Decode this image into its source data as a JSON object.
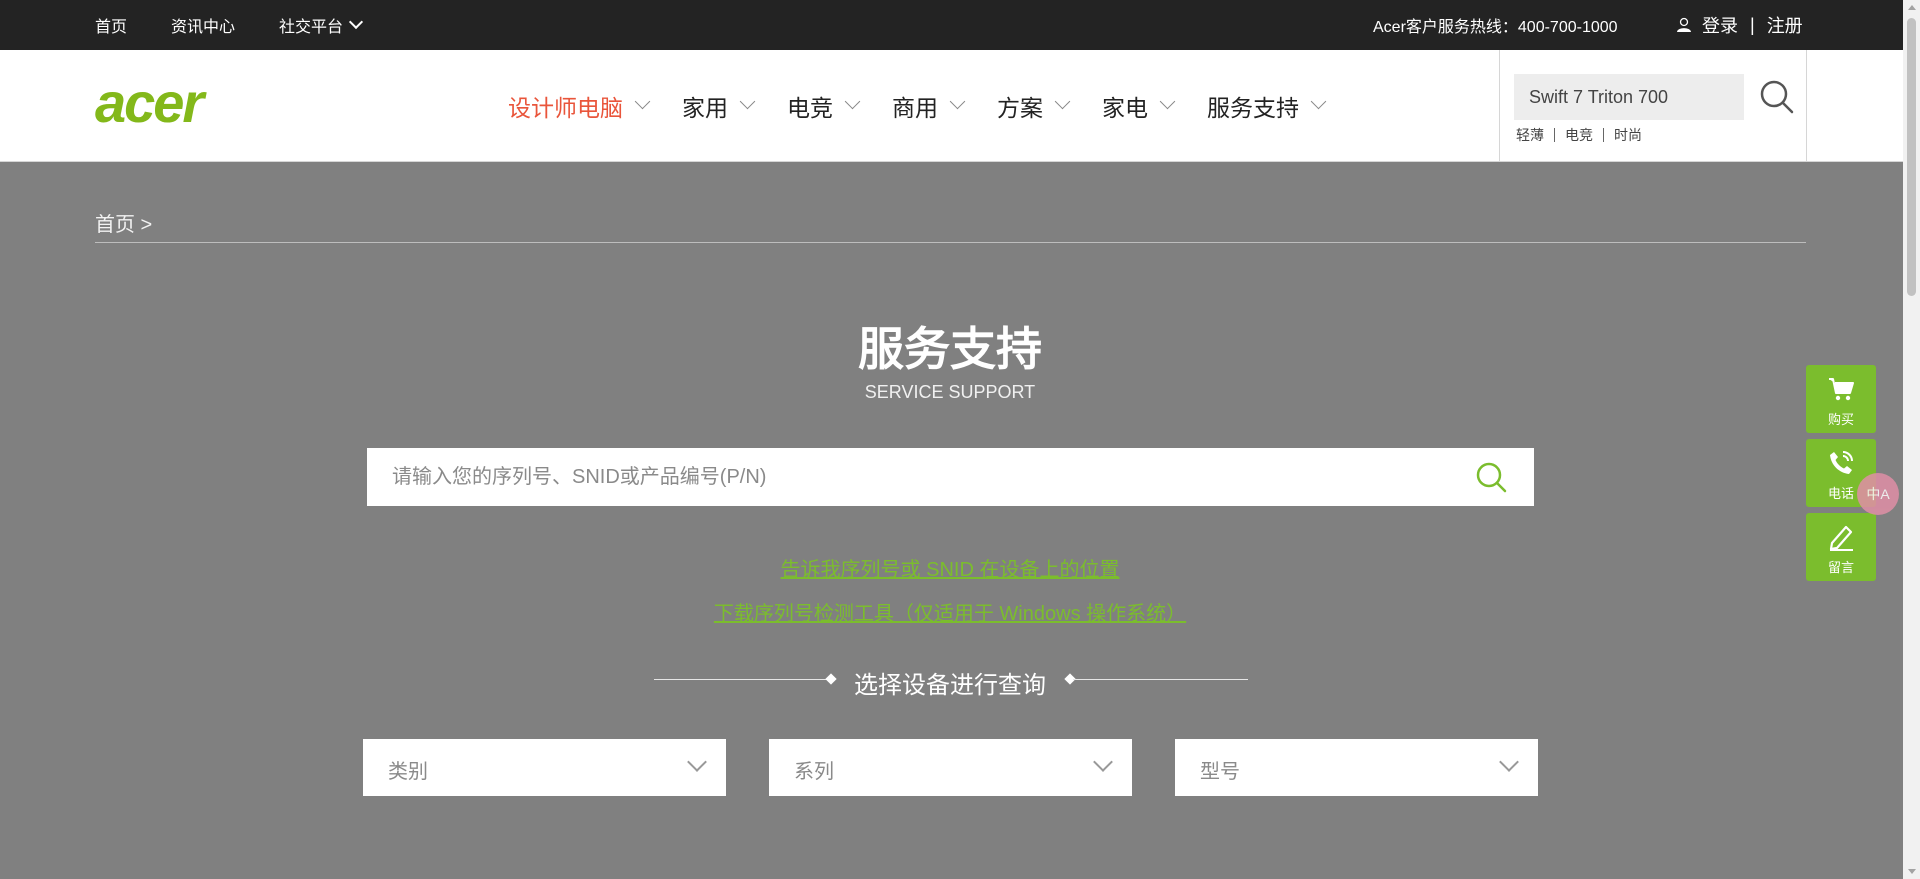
{
  "topbar": {
    "nav": [
      {
        "label": "首页"
      },
      {
        "label": "资讯中心"
      },
      {
        "label": "社交平台"
      }
    ],
    "hotline": "Acer客户服务热线：400-700-1000",
    "login": "登录",
    "separator": "|",
    "register": "注册"
  },
  "header": {
    "logo_text": "acer",
    "nav": [
      {
        "label": "设计师电脑"
      },
      {
        "label": "家用"
      },
      {
        "label": "电竞"
      },
      {
        "label": "商用"
      },
      {
        "label": "方案"
      },
      {
        "label": "家电"
      },
      {
        "label": "服务支持"
      }
    ],
    "search_value": "Swift 7 Triton 700",
    "hotwords": [
      "轻薄",
      "电竞",
      "时尚"
    ]
  },
  "breadcrumb": "首页 >",
  "main": {
    "title": "服务支持",
    "subtitle": "SERVICE SUPPORT",
    "search_placeholder": "请输入您的序列号、SNID或产品编号(P/N)",
    "link1": "告诉我序列号或 SNID 在设备上的位置",
    "link2": "下载序列号检测工具（仅适用于 Windows 操作系统）",
    "section_heading": "选择设备进行查询",
    "selects": [
      {
        "label": "类别"
      },
      {
        "label": "系列"
      },
      {
        "label": "型号"
      }
    ]
  },
  "floatbar": [
    {
      "label": "购买",
      "icon": "cart-icon"
    },
    {
      "label": "电话",
      "icon": "phone-icon"
    },
    {
      "label": "留言",
      "icon": "pen-icon"
    }
  ],
  "translate_widget": "中A",
  "colors": {
    "accent": "#7bbd2d",
    "active_nav": "#e9553b",
    "topbar_bg": "#232323",
    "overlay_bg": "#808080"
  }
}
